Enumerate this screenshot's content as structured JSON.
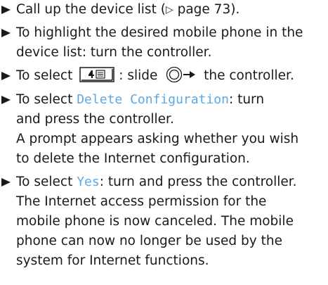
{
  "steps": [
    {
      "lines": [
        {
          "pre": "Call up the device list (",
          "tri": "▷",
          "post": " page 73)."
        }
      ]
    },
    {
      "lines": [
        "To highlight the desired mobile phone in the",
        "device list: turn the controller."
      ]
    },
    {
      "pre": "To select ",
      "mid": ": slide ",
      "post": " the controller."
    },
    {
      "pre": "To select ",
      "command": "Delete Configuration",
      "post": ": turn",
      "lines": [
        "and press the controller.",
        "A prompt appears asking whether you wish",
        "to delete the Internet configuration."
      ]
    },
    {
      "pre": "To select ",
      "command": "Yes",
      "post": ": turn and press the controller.",
      "lines": [
        "The Internet access permission for the",
        "mobile phone is now canceled. The mobile",
        "phone can now no longer be used by the",
        "system for Internet functions."
      ]
    }
  ],
  "icons": {
    "menu_icon": "phone-menu-icon",
    "controller_icon": "controller-slide-right-icon",
    "bullet_icon": "bullet-triangle-icon"
  }
}
